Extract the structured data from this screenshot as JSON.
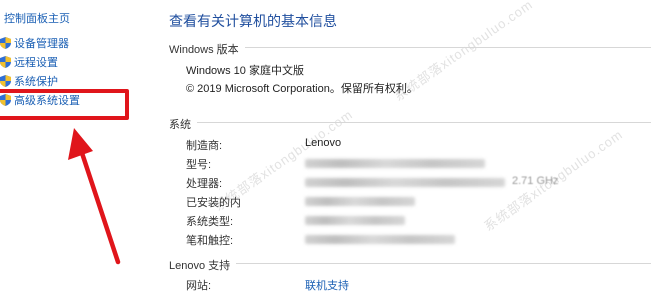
{
  "sidebar": {
    "home_link": "控制面板主页",
    "items": [
      {
        "label": "设备管理器",
        "icon": "shield-icon"
      },
      {
        "label": "远程设置",
        "icon": "shield-icon"
      },
      {
        "label": "系统保护",
        "icon": "shield-icon"
      },
      {
        "label": "高级系统设置",
        "icon": "shield-icon"
      }
    ]
  },
  "main": {
    "title": "查看有关计算机的基本信息",
    "windows_section": {
      "heading": "Windows 版本",
      "edition": "Windows 10 家庭中文版",
      "copyright": "© 2019 Microsoft Corporation。保留所有权利。"
    },
    "system_section": {
      "heading": "系统",
      "rows": [
        {
          "label": "制造商:",
          "value": "Lenovo"
        },
        {
          "label": "型号:",
          "value": ""
        },
        {
          "label": "处理器:",
          "value": "2.71 GHz"
        },
        {
          "label": "已安装的内",
          "value": ""
        },
        {
          "label": "系统类型:",
          "value": ""
        },
        {
          "label": "笔和触控:",
          "value": ""
        }
      ]
    },
    "support_section": {
      "heading": "Lenovo 支持",
      "website_label": "网站:",
      "website_link": "联机支持"
    }
  },
  "annotation": {
    "highlight_color": "#e0151b"
  },
  "watermark": "系统部落xitongbuluo.com"
}
